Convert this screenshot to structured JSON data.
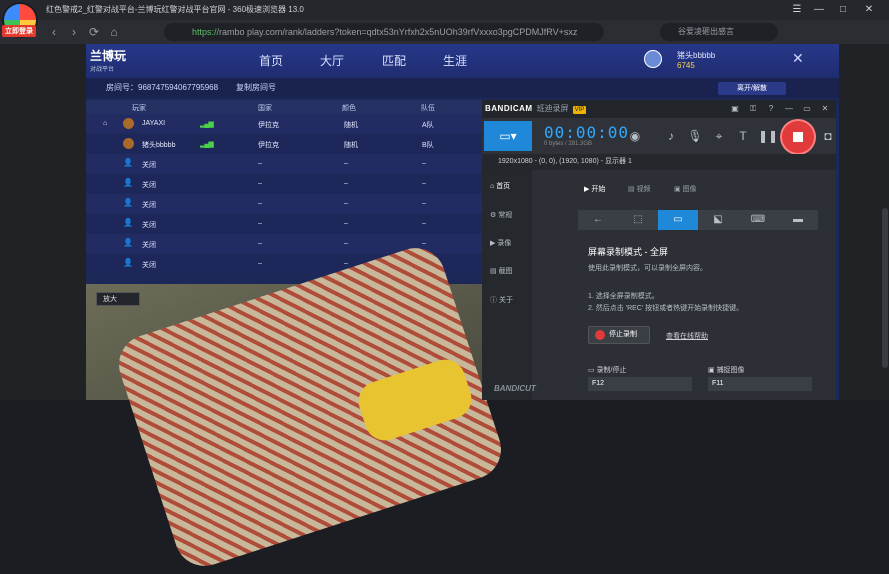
{
  "browser": {
    "window_title": "红色警戒2_红警对战平台-兰博玩红警对战平台官网 - 360极速浏览器 13.0",
    "login_badge": "立即登录",
    "address": "rambo play.com/rank/ladders?token=qdtx53nYrfxh2x5nUOh39rfVxxxo3pgCPDMJfRV+sxz",
    "secure_label": "https://",
    "search_placeholder": "谷爱凌砸出感言",
    "nav": {
      "back": "‹",
      "forward": "›",
      "refresh": "⟳",
      "home": "⌂"
    }
  },
  "site": {
    "logo_title": "兰博玩",
    "logo_sub": "对战平台",
    "nav": [
      "首页",
      "大厅",
      "匹配",
      "生涯"
    ],
    "user": {
      "name": "猪头bbbbb",
      "coins": "6745"
    },
    "room": {
      "number_label": "房间号：968747594067795968",
      "copy_label": "复制房间号",
      "leave_label": "离开/解散"
    },
    "table_headers": {
      "player": "玩家",
      "country": "国家",
      "color": "颜色",
      "team": "队伍"
    },
    "players": [
      {
        "name": "JAYAXI",
        "country": "伊拉克",
        "color": "随机",
        "team": "A队",
        "has_avatar": true
      },
      {
        "name": "猪头bbbbb",
        "country": "伊拉克",
        "color": "随机",
        "team": "B队",
        "has_avatar": true
      },
      {
        "name": "关闭",
        "country": "–",
        "color": "–",
        "team": "–",
        "has_avatar": false
      },
      {
        "name": "关闭",
        "country": "–",
        "color": "–",
        "team": "–",
        "has_avatar": false
      },
      {
        "name": "关闭",
        "country": "–",
        "color": "–",
        "team": "–",
        "has_avatar": false
      },
      {
        "name": "关闭",
        "country": "–",
        "color": "–",
        "team": "–",
        "has_avatar": false
      },
      {
        "name": "关闭",
        "country": "–",
        "color": "–",
        "team": "–",
        "has_avatar": false
      },
      {
        "name": "关闭",
        "country": "–",
        "color": "–",
        "team": "–",
        "has_avatar": false
      }
    ],
    "enlarge_label": "放大"
  },
  "bandicam": {
    "brand": "BANDICAM",
    "tag": "班迪录屏",
    "vip": "VIP",
    "timer": "00:00:00",
    "bytes": "0 bytes / 281.3GB",
    "resolution": "1920x1080 - (0, 0), (1920, 1080) - 显示器 1",
    "side": [
      "首页",
      "常规",
      "录像",
      "截图",
      "关于"
    ],
    "tabs": [
      "开始",
      "视频",
      "图像"
    ],
    "mode_title": "屏幕录制模式 - 全屏",
    "mode_desc": "使用此录制模式，可以录制全屏内容。",
    "step1": "1. 选择全屏录制模式。",
    "step2": "2. 然后点击 'REC' 按钮或者热键开始录制快捷键。",
    "stop_label": "停止录制",
    "help_label": "查看在线帮助",
    "hotkey_rec_label": "录制/停止",
    "hotkey_rec": "F12",
    "hotkey_cap_label": "捕捉图像",
    "hotkey_cap": "F11",
    "footer_logo": "BANDICUT"
  }
}
